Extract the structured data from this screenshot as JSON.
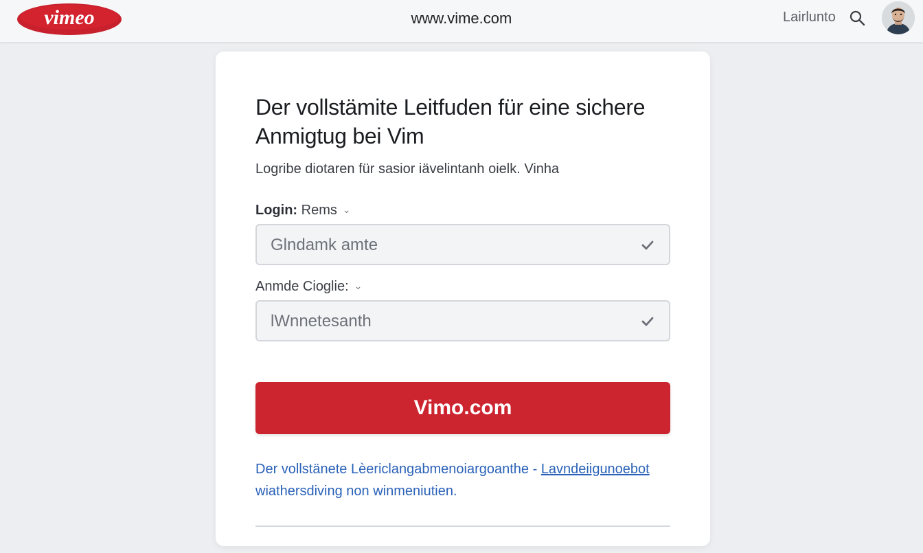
{
  "header": {
    "logo_text": "vimeo",
    "url": "www.vime.com",
    "account_label": "Lairlunto",
    "search_icon": "search-icon",
    "avatar_icon": "avatar"
  },
  "card": {
    "title": "Der vollstämite Leitfuden für eine sichere Anmigtug bei Vim",
    "subtitle": "Logribe diotaren für sasior iävelintanh oielk. Vinha",
    "fields": [
      {
        "label_bold": "Login:",
        "label_rest": " Rems",
        "value": "Glndamk amte",
        "icon": "check-icon"
      },
      {
        "label_bold": "",
        "label_rest": "Anmde Cioglie:",
        "value": "lWnnetesanth",
        "icon": "check-icon"
      }
    ],
    "primary_button": "Vimo.com",
    "footer": {
      "text": "Der vollstänete Lèericlangabmenoiargoanthe - ",
      "link": "Lavndeiigunoebot",
      "text2": "wiathersdiving non winmeniutien."
    }
  },
  "colors": {
    "brand_red": "#cc2530",
    "link_blue": "#2a62b8"
  }
}
